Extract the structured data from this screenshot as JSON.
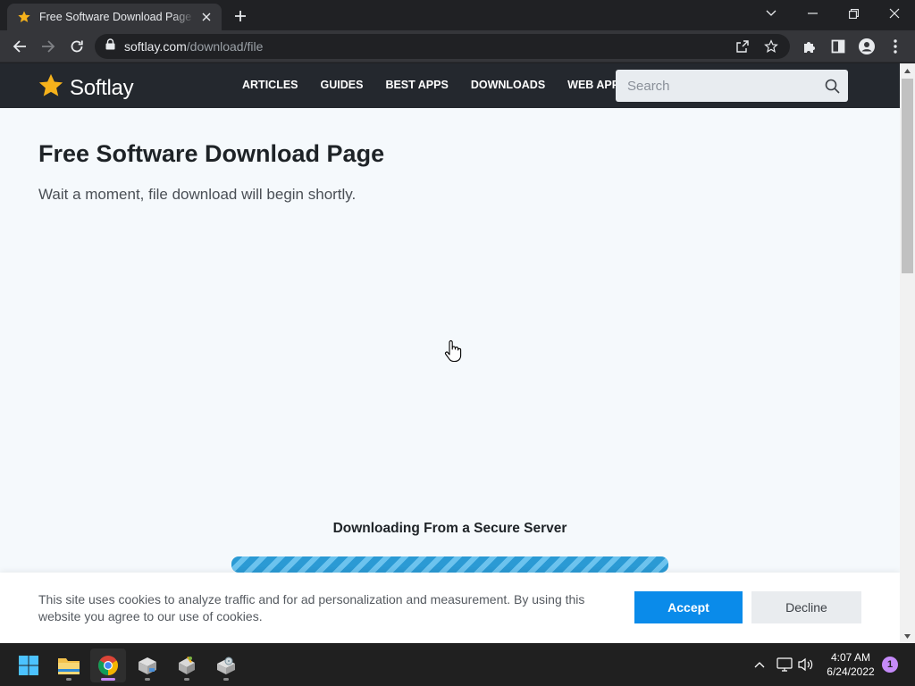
{
  "browser": {
    "tab_title": "Free Software Download Page - Softlay",
    "url_domain": "softlay.com",
    "url_path": "/download/file"
  },
  "site": {
    "logo_text": "Softlay",
    "nav": [
      "ARTICLES",
      "GUIDES",
      "BEST APPS",
      "DOWNLOADS",
      "WEB APPS"
    ],
    "search_placeholder": "Search"
  },
  "page": {
    "title": "Free Software Download Page",
    "subtitle": "Wait a moment, file download will begin shortly.",
    "download_heading": "Downloading From a Secure Server"
  },
  "cookie_banner": {
    "text": "This site uses cookies to analyze traffic and for ad personalization and measurement. By using this website you agree to our use of cookies.",
    "accept_label": "Accept",
    "decline_label": "Decline"
  },
  "taskbar": {
    "time": "4:07 AM",
    "date": "6/24/2022",
    "notification_count": "1"
  },
  "colors": {
    "accent": "#0a8bea",
    "header_bg": "#24282e",
    "logo_star": "#f6b21b"
  }
}
